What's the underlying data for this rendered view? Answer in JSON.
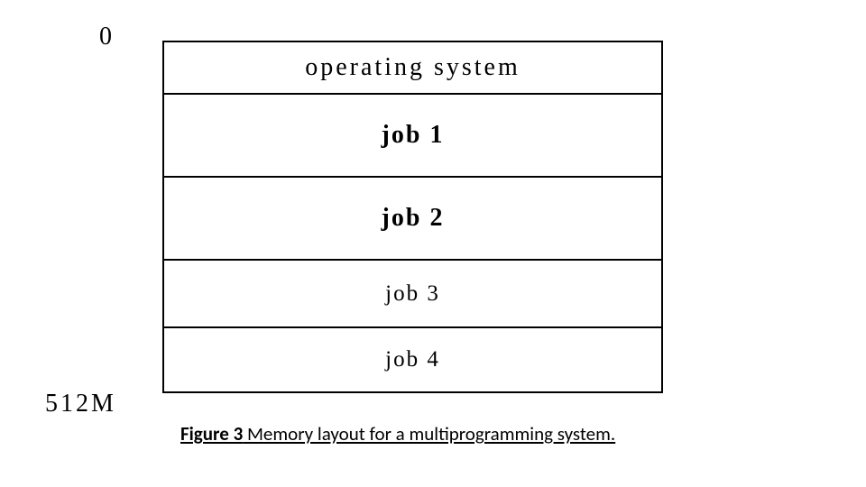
{
  "labels": {
    "top": "0",
    "bottom": "512M"
  },
  "memory": {
    "rows": [
      "operating system",
      "job 1",
      "job 2",
      "job 3",
      "job 4"
    ]
  },
  "caption": {
    "bold": "Figure 3",
    "rest": " Memory layout for a multiprogramming system."
  }
}
